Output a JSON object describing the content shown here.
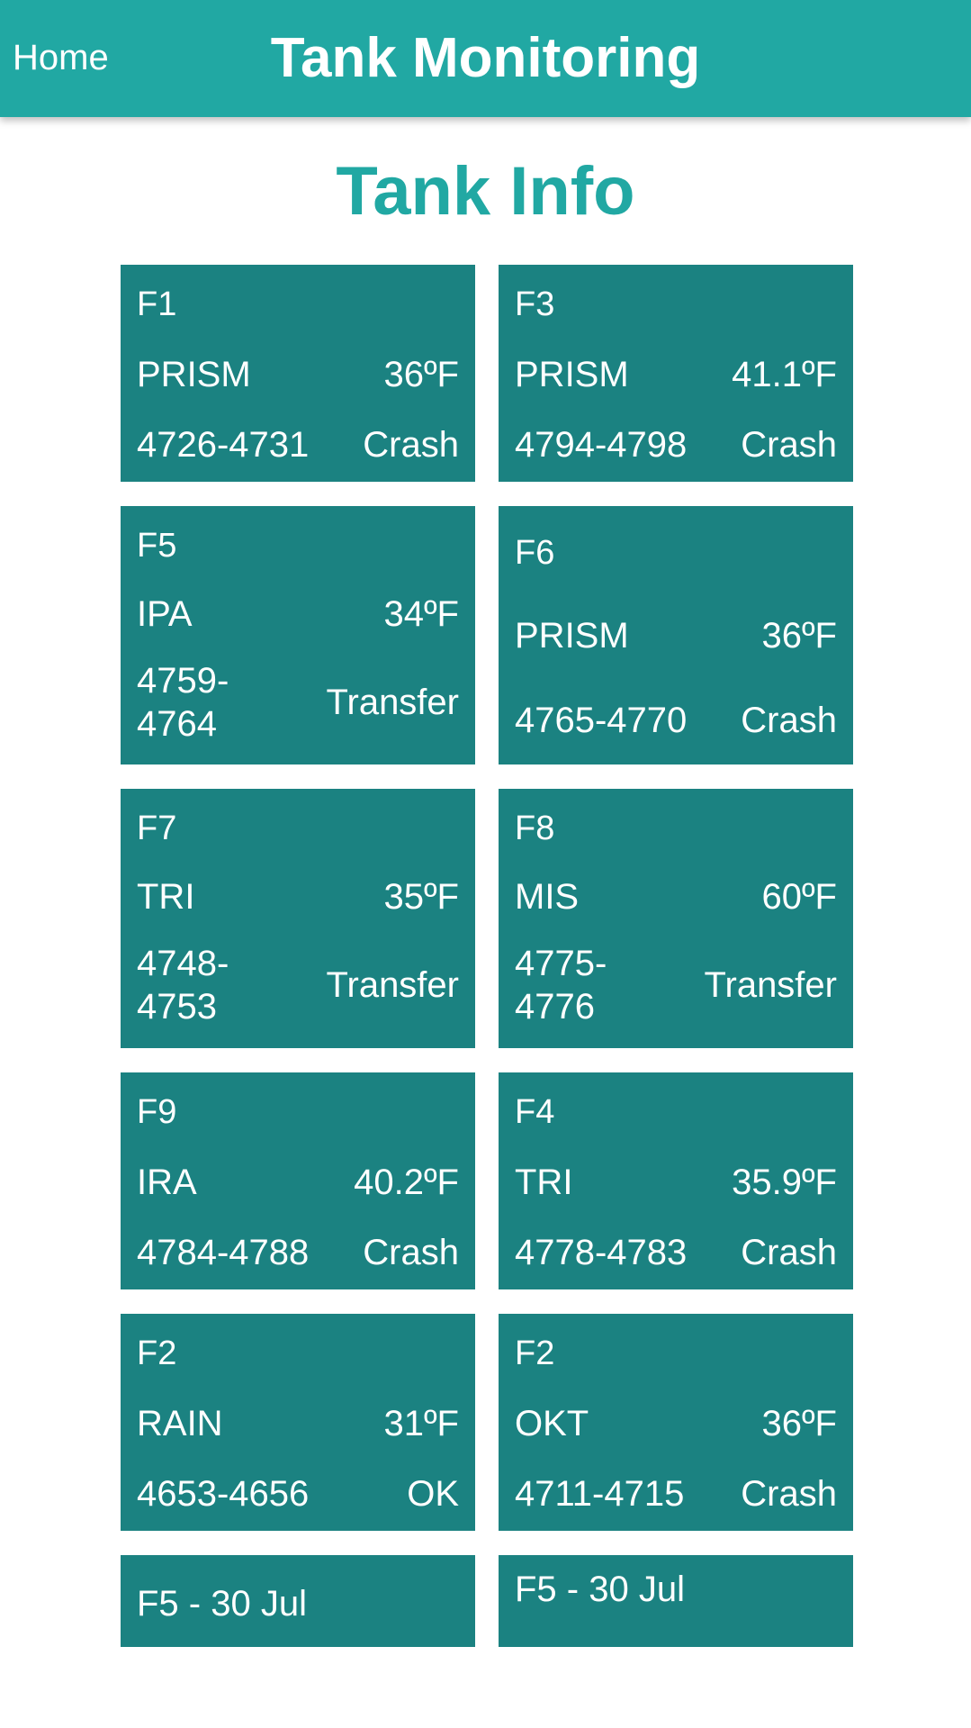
{
  "header": {
    "home_label": "Home",
    "title": "Tank Monitoring"
  },
  "page_title": "Tank Info",
  "tanks": [
    {
      "name": "F1",
      "product": "PRISM",
      "temperature": "36ºF",
      "batch": "4726-4731",
      "status": "Crash"
    },
    {
      "name": "F3",
      "product": "PRISM",
      "temperature": "41.1ºF",
      "batch": "4794-4798",
      "status": "Crash"
    },
    {
      "name": "F5",
      "product": "IPA",
      "temperature": "34ºF",
      "batch": "4759-4764",
      "status": "Transfer"
    },
    {
      "name": "F6",
      "product": "PRISM",
      "temperature": "36ºF",
      "batch": "4765-4770",
      "status": "Crash"
    },
    {
      "name": "F7",
      "product": "TRI",
      "temperature": "35ºF",
      "batch": "4748-4753",
      "status": "Transfer"
    },
    {
      "name": "F8",
      "product": "MIS",
      "temperature": "60ºF",
      "batch": "4775-4776",
      "status": "Transfer"
    },
    {
      "name": "F9",
      "product": "IRA",
      "temperature": "40.2ºF",
      "batch": "4784-4788",
      "status": "Crash"
    },
    {
      "name": "F4",
      "product": "TRI",
      "temperature": "35.9ºF",
      "batch": "4778-4783",
      "status": "Crash"
    },
    {
      "name": "F2",
      "product": "RAIN",
      "temperature": "31ºF",
      "batch": "4653-4656",
      "status": "OK"
    },
    {
      "name": "F2",
      "product": "OKT",
      "temperature": "36ºF",
      "batch": "4711-4715",
      "status": "Crash"
    }
  ],
  "notes": [
    {
      "label": "F5 - 30 Jul"
    },
    {
      "label": "F5 - 30 Jul"
    }
  ],
  "colors": {
    "header_bg": "#21a8a3",
    "card_bg": "#1b8281",
    "title_color": "#21a8a3"
  }
}
